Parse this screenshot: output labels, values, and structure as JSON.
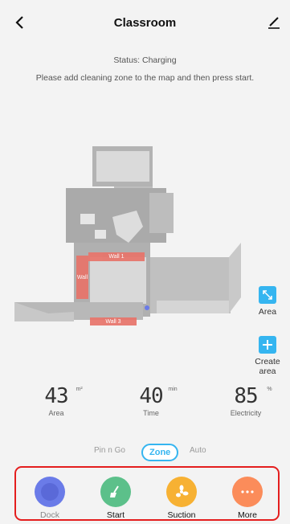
{
  "header": {
    "title": "Classroom"
  },
  "status": {
    "text": "Status: Charging"
  },
  "hint": {
    "text": "Please add cleaning zone to the map and then press start."
  },
  "map": {
    "zones": [
      {
        "label": "Wall 1"
      },
      {
        "label": "Wall"
      },
      {
        "label": "Wall 3"
      }
    ]
  },
  "side_actions": {
    "area_label": "Area",
    "create_area_label": "Create area"
  },
  "stats": {
    "area": {
      "value": "43",
      "unit": "m²",
      "label": "Area"
    },
    "time": {
      "value": "40",
      "unit": "min",
      "label": "Time"
    },
    "electricity": {
      "value": "85",
      "unit": "%",
      "label": "Electricity"
    }
  },
  "modes": {
    "items": [
      "Pin n Go",
      "Zone",
      "Auto"
    ],
    "selected": "Zone"
  },
  "controls": {
    "dock": {
      "label": "Dock",
      "color": "#6a7be8"
    },
    "start": {
      "label": "Start",
      "color": "#5cc08a"
    },
    "suction": {
      "label": "Suction",
      "color": "#f7b133"
    },
    "more": {
      "label": "More",
      "color": "#fb8c5a"
    }
  },
  "colors": {
    "accent": "#35b5f0",
    "zone": "#e8746a",
    "highlight_border": "#e41e1e"
  }
}
